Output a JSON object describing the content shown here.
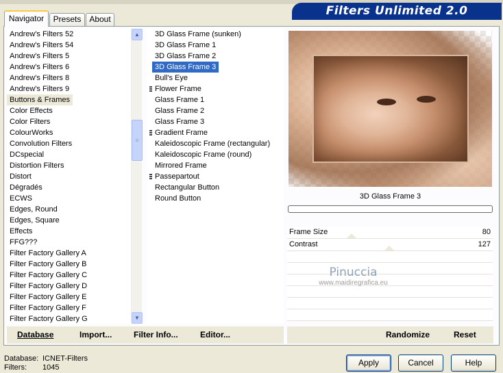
{
  "tabs": [
    "Navigator",
    "Presets",
    "About"
  ],
  "banner": "Filters Unlimited 2.0",
  "categories": [
    "Andrew's Filters 52",
    "Andrew's Filters 54",
    "Andrew's Filters 5",
    "Andrew's Filters 6",
    "Andrew's Filters 8",
    "Andrew's Filters 9",
    "Buttons & Frames",
    "Color Effects",
    "Color Filters",
    "ColourWorks",
    "Convolution Filters",
    "DCspecial",
    "Distortion Filters",
    "Distort",
    "Dégradés",
    "ECWS",
    "Edges, Round",
    "Edges, Square",
    "Effects",
    "FFG???",
    "Filter Factory Gallery A",
    "Filter Factory Gallery B",
    "Filter Factory Gallery C",
    "Filter Factory Gallery D",
    "Filter Factory Gallery E",
    "Filter Factory Gallery F",
    "Filter Factory Gallery G"
  ],
  "selected_category": "Buttons & Frames",
  "filters": [
    {
      "label": "3D Glass Frame (sunken)",
      "marked": false
    },
    {
      "label": "3D Glass Frame 1",
      "marked": false
    },
    {
      "label": "3D Glass Frame 2",
      "marked": false
    },
    {
      "label": "3D Glass Frame 3",
      "marked": false,
      "selected": true
    },
    {
      "label": "Bull's Eye",
      "marked": false
    },
    {
      "label": "Flower Frame",
      "marked": true
    },
    {
      "label": "Glass Frame 1",
      "marked": false
    },
    {
      "label": "Glass Frame 2",
      "marked": false
    },
    {
      "label": "Glass Frame 3",
      "marked": false
    },
    {
      "label": "Gradient Frame",
      "marked": true
    },
    {
      "label": "Kaleidoscopic Frame (rectangular)",
      "marked": false
    },
    {
      "label": "Kaleidoscopic Frame (round)",
      "marked": false
    },
    {
      "label": "Mirrored Frame",
      "marked": false
    },
    {
      "label": "Passepartout",
      "marked": true
    },
    {
      "label": "Rectangular Button",
      "marked": false
    },
    {
      "label": "Round Button",
      "marked": false
    }
  ],
  "preview_caption": "3D Glass Frame 3",
  "params": [
    {
      "name": "Frame Size",
      "value": "80",
      "level": 0.314
    },
    {
      "name": "Contrast",
      "value": "127",
      "level": 0.498
    }
  ],
  "watermark": {
    "line1": "Pinuccia",
    "line2": "www.maidiregrafica.eu"
  },
  "left_buttons": [
    "Database",
    "Import...",
    "Filter Info...",
    "Editor..."
  ],
  "right_buttons": [
    "Randomize",
    "Reset"
  ],
  "status": {
    "database_label": "Database:",
    "database_value": "ICNET-Filters",
    "filters_label": "Filters:",
    "filters_value": "1045"
  },
  "dialog_buttons": {
    "apply": "Apply",
    "cancel": "Cancel",
    "help": "Help"
  }
}
